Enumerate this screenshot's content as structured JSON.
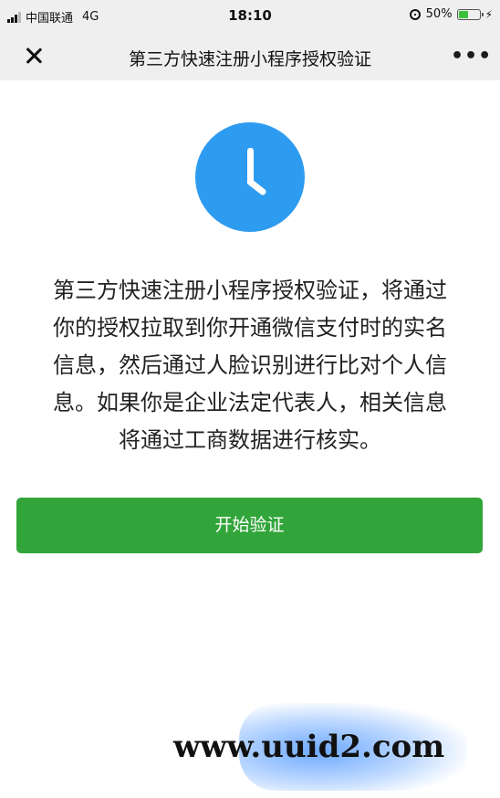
{
  "status_bar": {
    "carrier": "中国联通",
    "network": "4G",
    "time": "18:10",
    "battery_percent": "50%",
    "battery_level": 0.5
  },
  "nav": {
    "title": "第三方快速注册小程序授权验证",
    "more_label": "•••"
  },
  "content": {
    "description_lines": [
      "第三方快速注册小程序授权验证，将通过",
      "你的授权拉取到你开通微信支付时的实名",
      "信息，然后通过人脸识别进行比对个人信",
      "息。如果你是企业法定代表人，相关信息",
      "将通过工商数据进行核实。"
    ],
    "start_button_label": "开始验证"
  },
  "watermark": {
    "text": "www.uuid2.com"
  },
  "colors": {
    "accent_blue": "#2d9bf0",
    "button_green": "#32a53a",
    "bar_gray": "#efefef"
  },
  "icons": {
    "close": "close-icon",
    "more": "more-icon",
    "clock": "clock-icon"
  }
}
